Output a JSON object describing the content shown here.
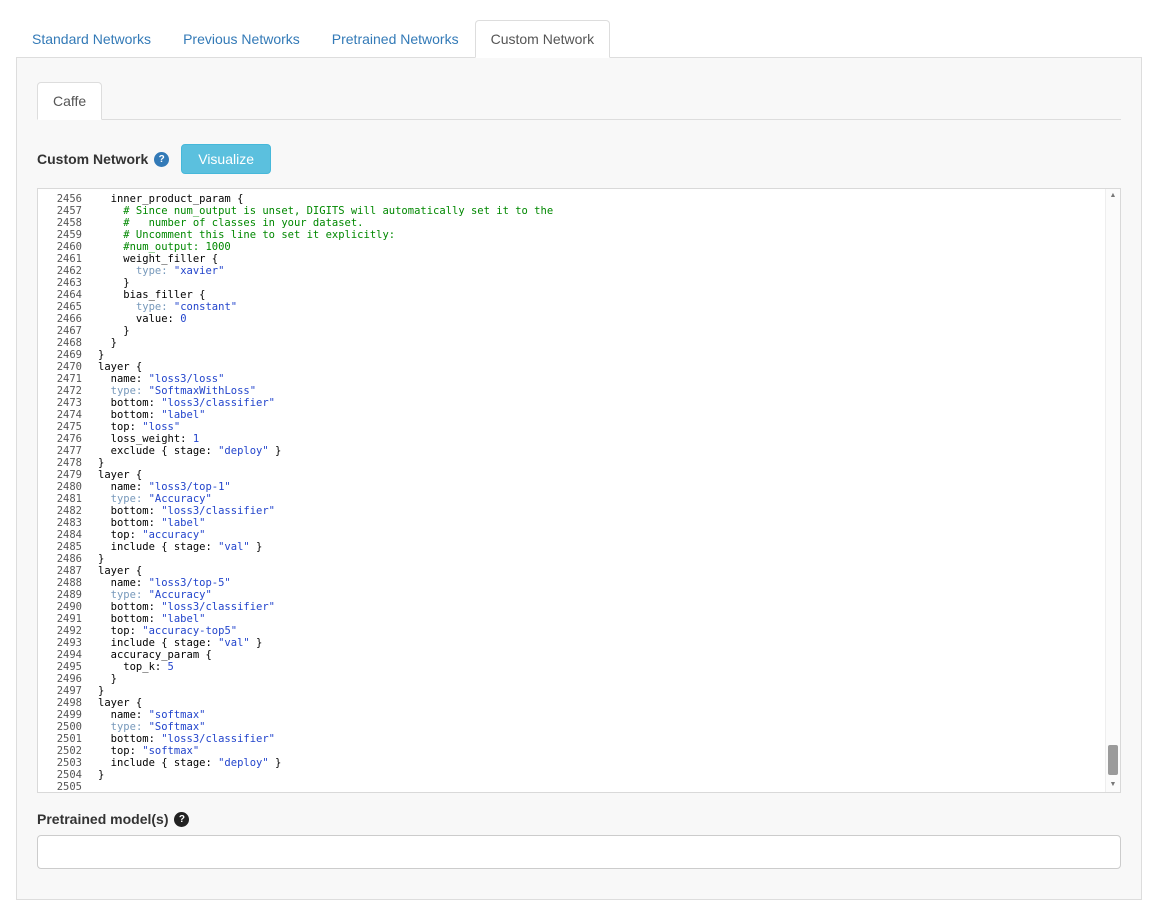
{
  "main_tabs": [
    {
      "label": "Standard Networks",
      "active": false
    },
    {
      "label": "Previous Networks",
      "active": false
    },
    {
      "label": "Pretrained Networks",
      "active": false
    },
    {
      "label": "Custom Network",
      "active": true
    }
  ],
  "framework_tabs": [
    {
      "label": "Caffe",
      "active": true
    }
  ],
  "editor_section": {
    "label": "Custom Network",
    "visualize_button": "Visualize"
  },
  "icons": {
    "help": "?",
    "scroll_up": "▲",
    "scroll_down": "▼"
  },
  "colors": {
    "tab_link": "#337ab7",
    "visualize_button_bg": "#5bc0de",
    "comment_token": "#008800",
    "string_token": "#2244cc",
    "type_key_token": "#7799bb",
    "panel_bg": "#f8f8f8"
  },
  "code_editor": {
    "first_line_number": 2456,
    "lines": [
      "  inner_product_param {",
      "    # Since num_output is unset, DIGITS will automatically set it to the",
      "    #   number of classes in your dataset.",
      "    # Uncomment this line to set it explicitly:",
      "    #num_output: 1000",
      "    weight_filler {",
      "      type: \"xavier\"",
      "    }",
      "    bias_filler {",
      "      type: \"constant\"",
      "      value: 0",
      "    }",
      "  }",
      "}",
      "layer {",
      "  name: \"loss3/loss\"",
      "  type: \"SoftmaxWithLoss\"",
      "  bottom: \"loss3/classifier\"",
      "  bottom: \"label\"",
      "  top: \"loss\"",
      "  loss_weight: 1",
      "  exclude { stage: \"deploy\" }",
      "}",
      "layer {",
      "  name: \"loss3/top-1\"",
      "  type: \"Accuracy\"",
      "  bottom: \"loss3/classifier\"",
      "  bottom: \"label\"",
      "  top: \"accuracy\"",
      "  include { stage: \"val\" }",
      "}",
      "layer {",
      "  name: \"loss3/top-5\"",
      "  type: \"Accuracy\"",
      "  bottom: \"loss3/classifier\"",
      "  bottom: \"label\"",
      "  top: \"accuracy-top5\"",
      "  include { stage: \"val\" }",
      "  accuracy_param {",
      "    top_k: 5",
      "  }",
      "}",
      "layer {",
      "  name: \"softmax\"",
      "  type: \"Softmax\"",
      "  bottom: \"loss3/classifier\"",
      "  top: \"softmax\"",
      "  include { stage: \"deploy\" }",
      "}",
      ""
    ]
  },
  "pretrained": {
    "label": "Pretrained model(s)",
    "input_value": ""
  }
}
